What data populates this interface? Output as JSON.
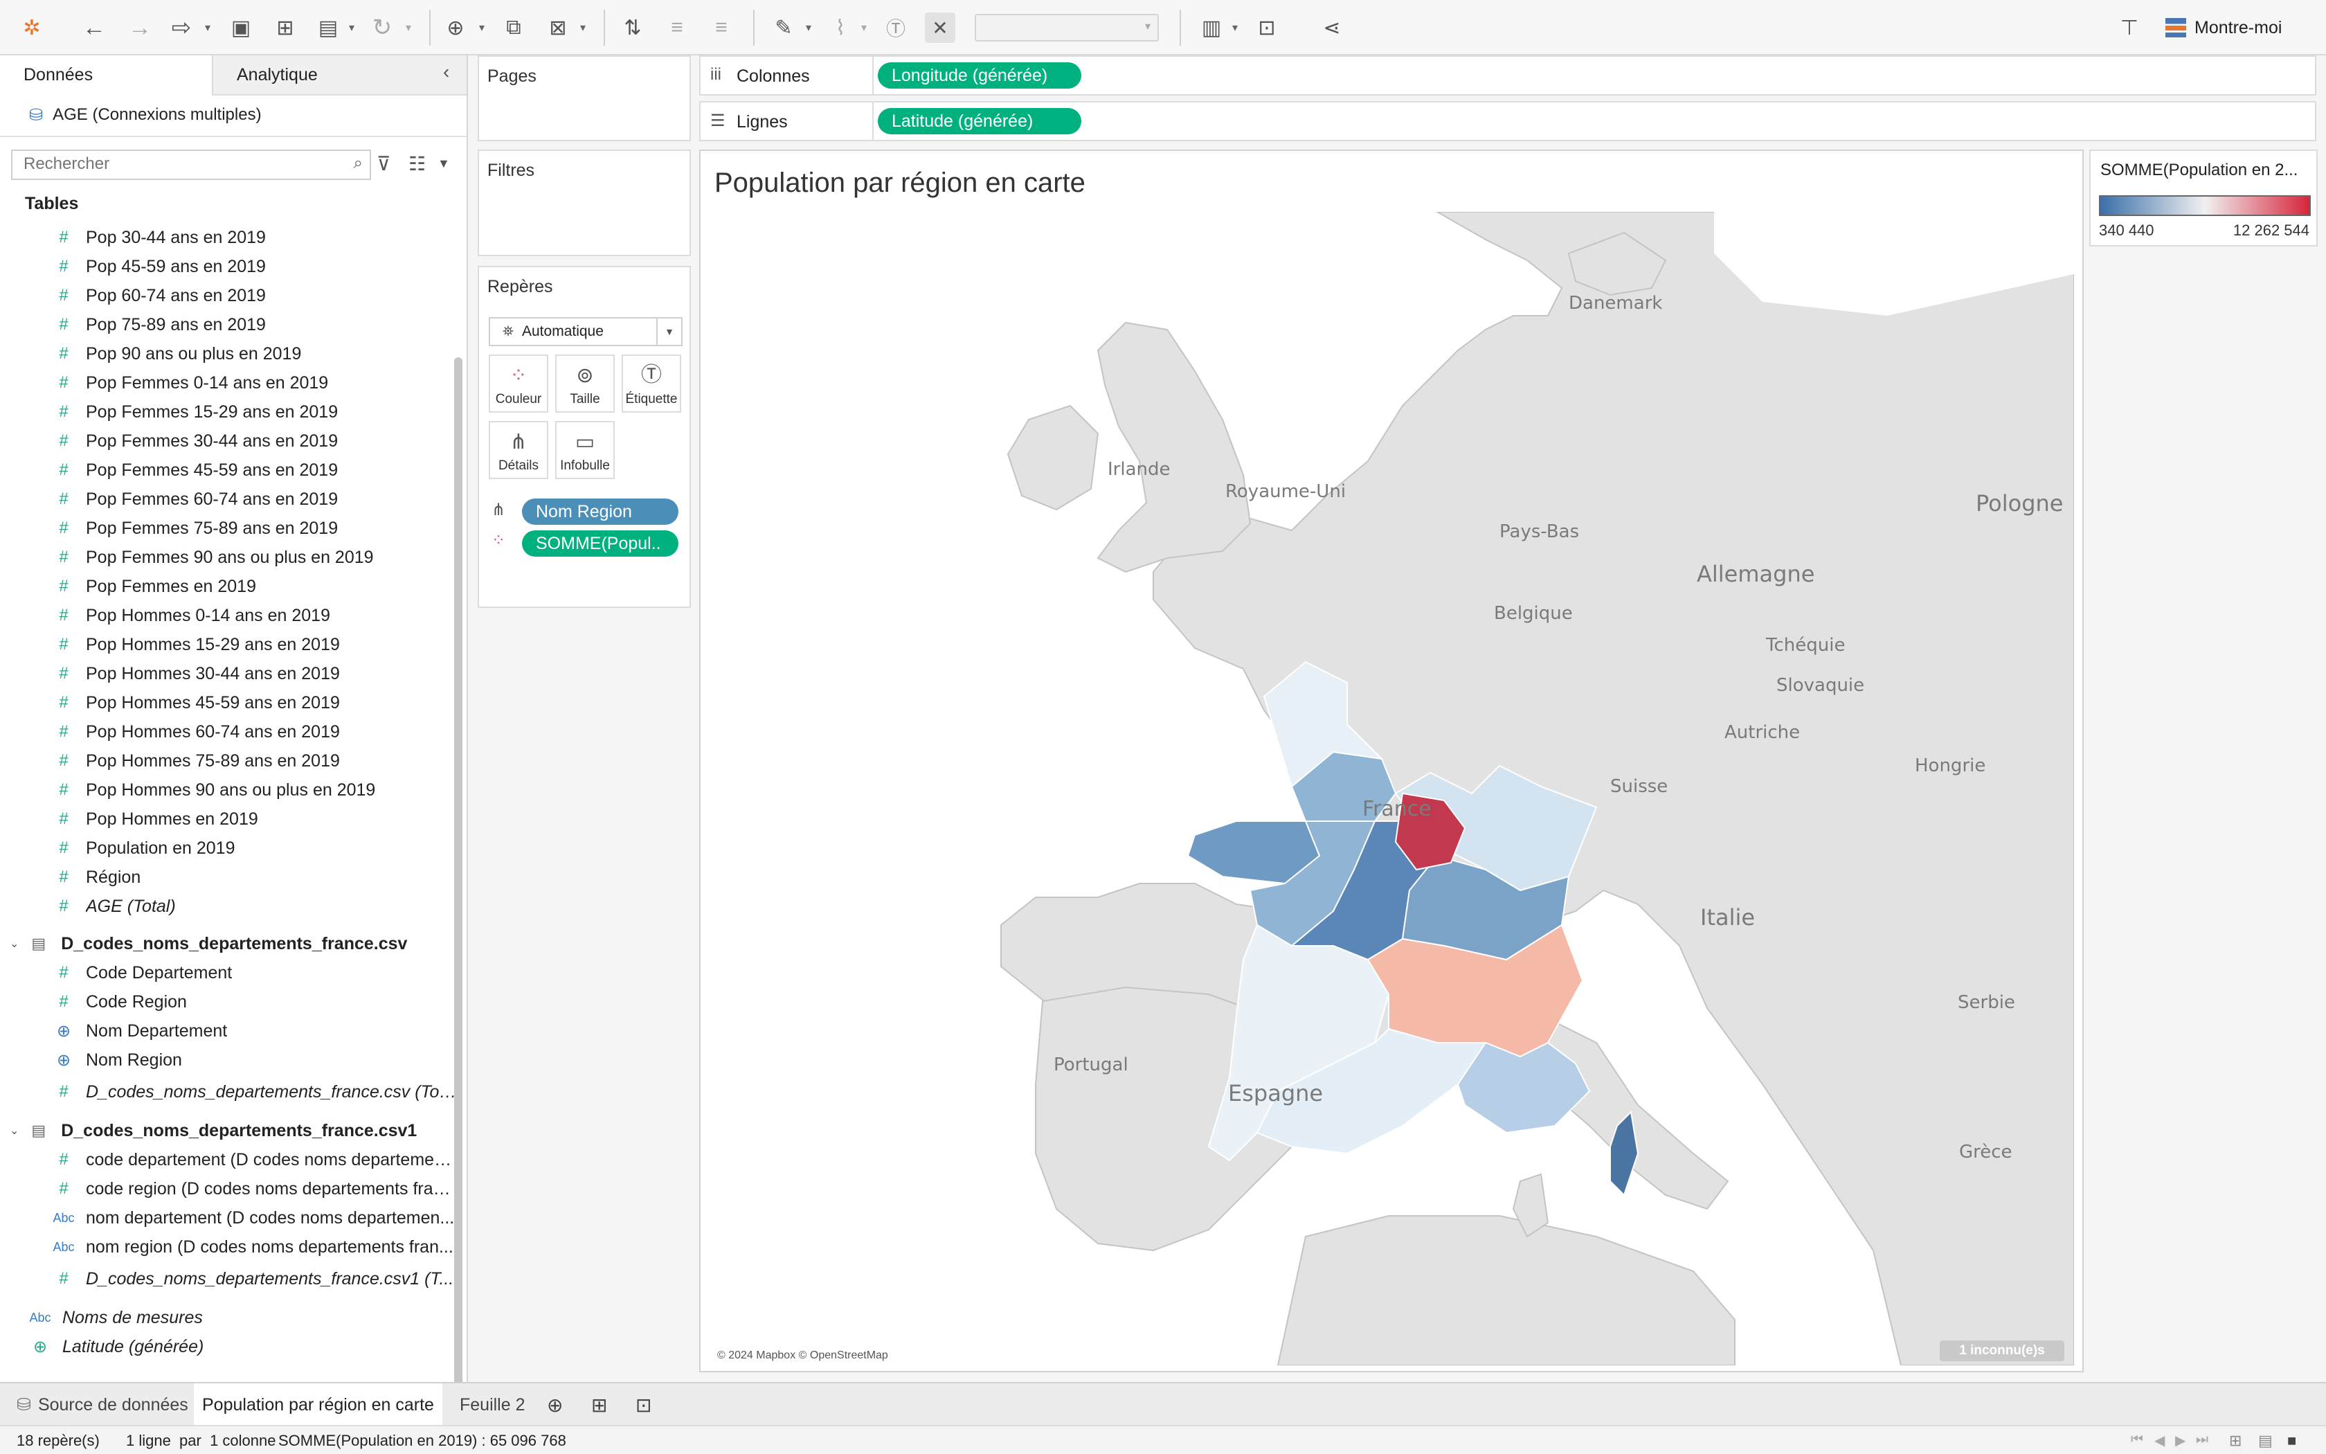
{
  "toolbar": {
    "sheet_select_placeholder": "",
    "show_me_label": "Montre-moi"
  },
  "data_pane": {
    "tab_data": "Données",
    "tab_analytics": "Analytique",
    "datasource": "AGE (Connexions multiples)",
    "search_placeholder": "Rechercher",
    "tables_header": "Tables",
    "age_fields": [
      "Pop 30-44 ans en 2019",
      "Pop 45-59 ans en 2019",
      "Pop 60-74 ans en 2019",
      "Pop 75-89 ans en 2019",
      "Pop 90 ans ou plus en 2019",
      "Pop Femmes 0-14 ans en 2019",
      "Pop Femmes 15-29 ans en 2019",
      "Pop Femmes 30-44 ans en 2019",
      "Pop Femmes 45-59 ans en 2019",
      "Pop Femmes 60-74 ans en 2019",
      "Pop Femmes 75-89 ans en 2019",
      "Pop Femmes 90 ans ou plus en 2019",
      "Pop Femmes en 2019",
      "Pop Hommes 0-14 ans en 2019",
      "Pop Hommes 15-29 ans en 2019",
      "Pop Hommes 30-44 ans en 2019",
      "Pop Hommes 45-59 ans en 2019",
      "Pop Hommes 60-74 ans en 2019",
      "Pop Hommes 75-89 ans en 2019",
      "Pop Hommes 90 ans ou plus en 2019",
      "Pop Hommes en 2019",
      "Population en 2019",
      "Région"
    ],
    "age_total": "AGE (Total)",
    "table2_name": "D_codes_noms_departements_france.csv",
    "table2_fields": [
      "Code Departement",
      "Code Region",
      "Nom Departement",
      "Nom Region"
    ],
    "table2_total": "D_codes_noms_departements_france.csv (Tot...",
    "table3_name": "D_codes_noms_departements_france.csv1",
    "table3_fields": [
      "code departement (D codes noms departemen...",
      "code region (D codes noms departements fran...",
      "nom departement (D codes noms departemen...",
      "nom region (D codes noms departements fran..."
    ],
    "table3_total": "D_codes_noms_departements_france.csv1 (T...",
    "measure_names": "Noms de mesures",
    "latitude": "Latitude (générée)"
  },
  "shelves": {
    "pages": "Pages",
    "filters": "Filtres",
    "marks": "Repères",
    "mark_type": "Automatique",
    "mark_buttons": [
      "Couleur",
      "Taille",
      "Étiquette",
      "Détails",
      "Infobulle"
    ],
    "mark_pill_detail": "Nom Region",
    "mark_pill_color": "SOMME(Popul..",
    "columns_label": "Colonnes",
    "columns_pill": "Longitude (générée)",
    "rows_label": "Lignes",
    "rows_pill": "Latitude (générée)"
  },
  "view": {
    "title": "Population par région en carte",
    "attribution": "© 2024 Mapbox © OpenStreetMap",
    "unknown_badge": "1 inconnu(e)s",
    "map_labels": [
      "Danemark",
      "Irlande",
      "Royaume-Uni",
      "Pays-Bas",
      "Pologne",
      "Allemagne",
      "Belgique",
      "Tchéquie",
      "Slovaquie",
      "Autriche",
      "Hongrie",
      "Suisse",
      "France",
      "Italie",
      "Serbie",
      "Portugal",
      "Espagne",
      "Grèce"
    ]
  },
  "legend": {
    "title": "SOMME(Population en 2...",
    "min": "340 440",
    "max": "12 262 544",
    "color_low": "#3b6fa8",
    "color_mid": "#f0f0f0",
    "color_high": "#d6253b"
  },
  "tabs": {
    "datasource": "Source de données",
    "sheet1": "Population par région en carte",
    "sheet2": "Feuille 2"
  },
  "status": {
    "marks": "18 repère(s)",
    "dims": "1 ligne  par  1 colonne",
    "sum": "SOMME(Population en 2019) : 65 096 768"
  }
}
